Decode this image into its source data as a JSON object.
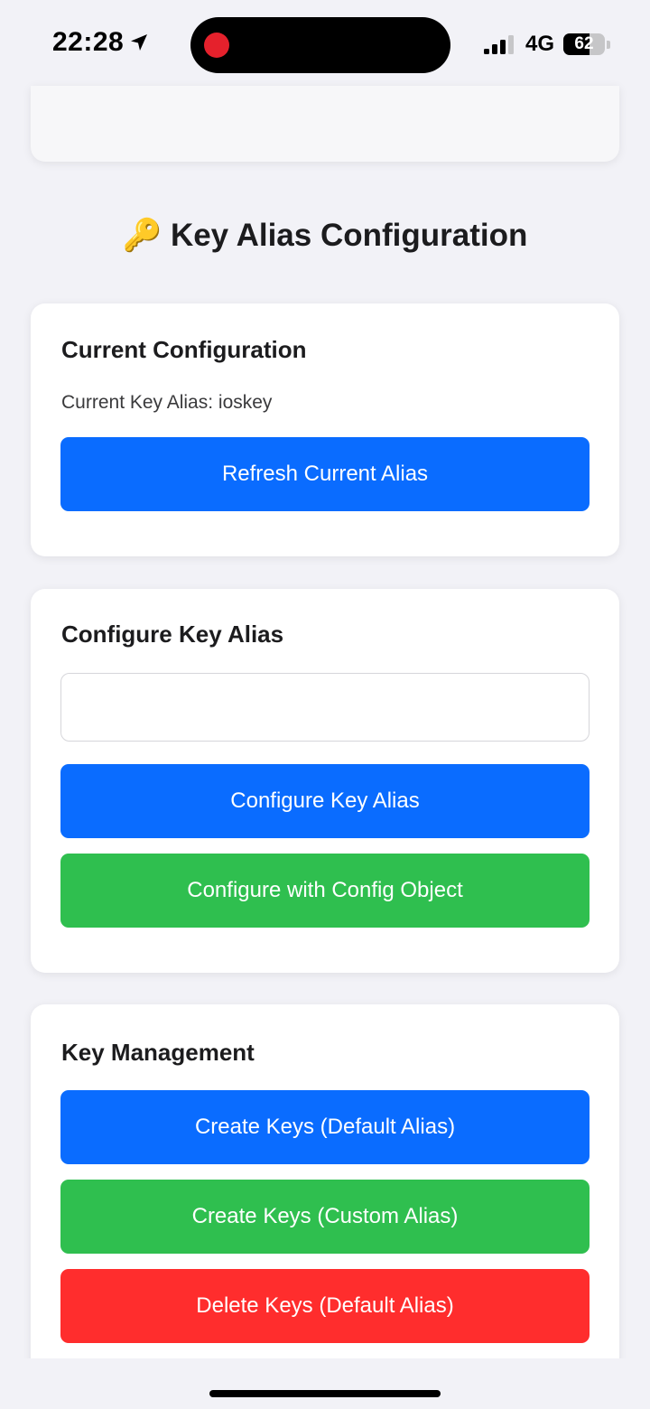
{
  "status_bar": {
    "time": "22:28",
    "network": "4G",
    "battery_level": "62",
    "battery_fraction": 0.62,
    "signal_bars_active": 3,
    "signal_bars_total": 4
  },
  "page": {
    "title": "🔑 Key Alias Configuration"
  },
  "current_config": {
    "title": "Current Configuration",
    "alias_text": "Current Key Alias: ioskey",
    "refresh_button": "Refresh Current Alias"
  },
  "configure_alias": {
    "title": "Configure Key Alias",
    "input_value": "",
    "configure_button": "Configure Key Alias",
    "configure_object_button": "Configure with Config Object"
  },
  "key_management": {
    "title": "Key Management",
    "create_default_button": "Create Keys (Default Alias)",
    "create_custom_button": "Create Keys (Custom Alias)",
    "delete_default_button": "Delete Keys (Default Alias)"
  },
  "colors": {
    "primary_blue": "#0a6cff",
    "success_green": "#2fbf4f",
    "danger_red": "#ff2d2d",
    "background": "#f2f2f7"
  }
}
